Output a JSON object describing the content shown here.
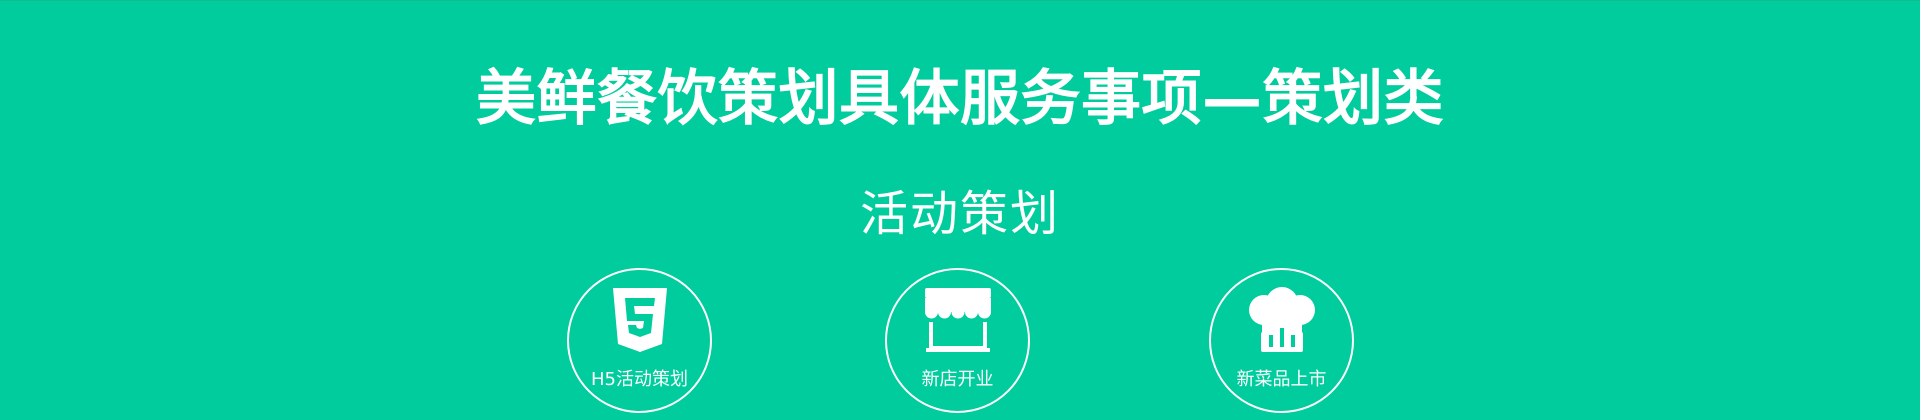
{
  "banner": {
    "title": "美鲜餐饮策划具体服务事项—策划类",
    "subtitle": "活动策划",
    "background_color": "#00cc9d",
    "foreground_color": "#ffffff",
    "services": [
      {
        "label": "H5活动策划",
        "icon": "html5-icon"
      },
      {
        "label": "新店开业",
        "icon": "storefront-icon"
      },
      {
        "label": "新菜品上市",
        "icon": "chef-hat-icon"
      }
    ]
  }
}
